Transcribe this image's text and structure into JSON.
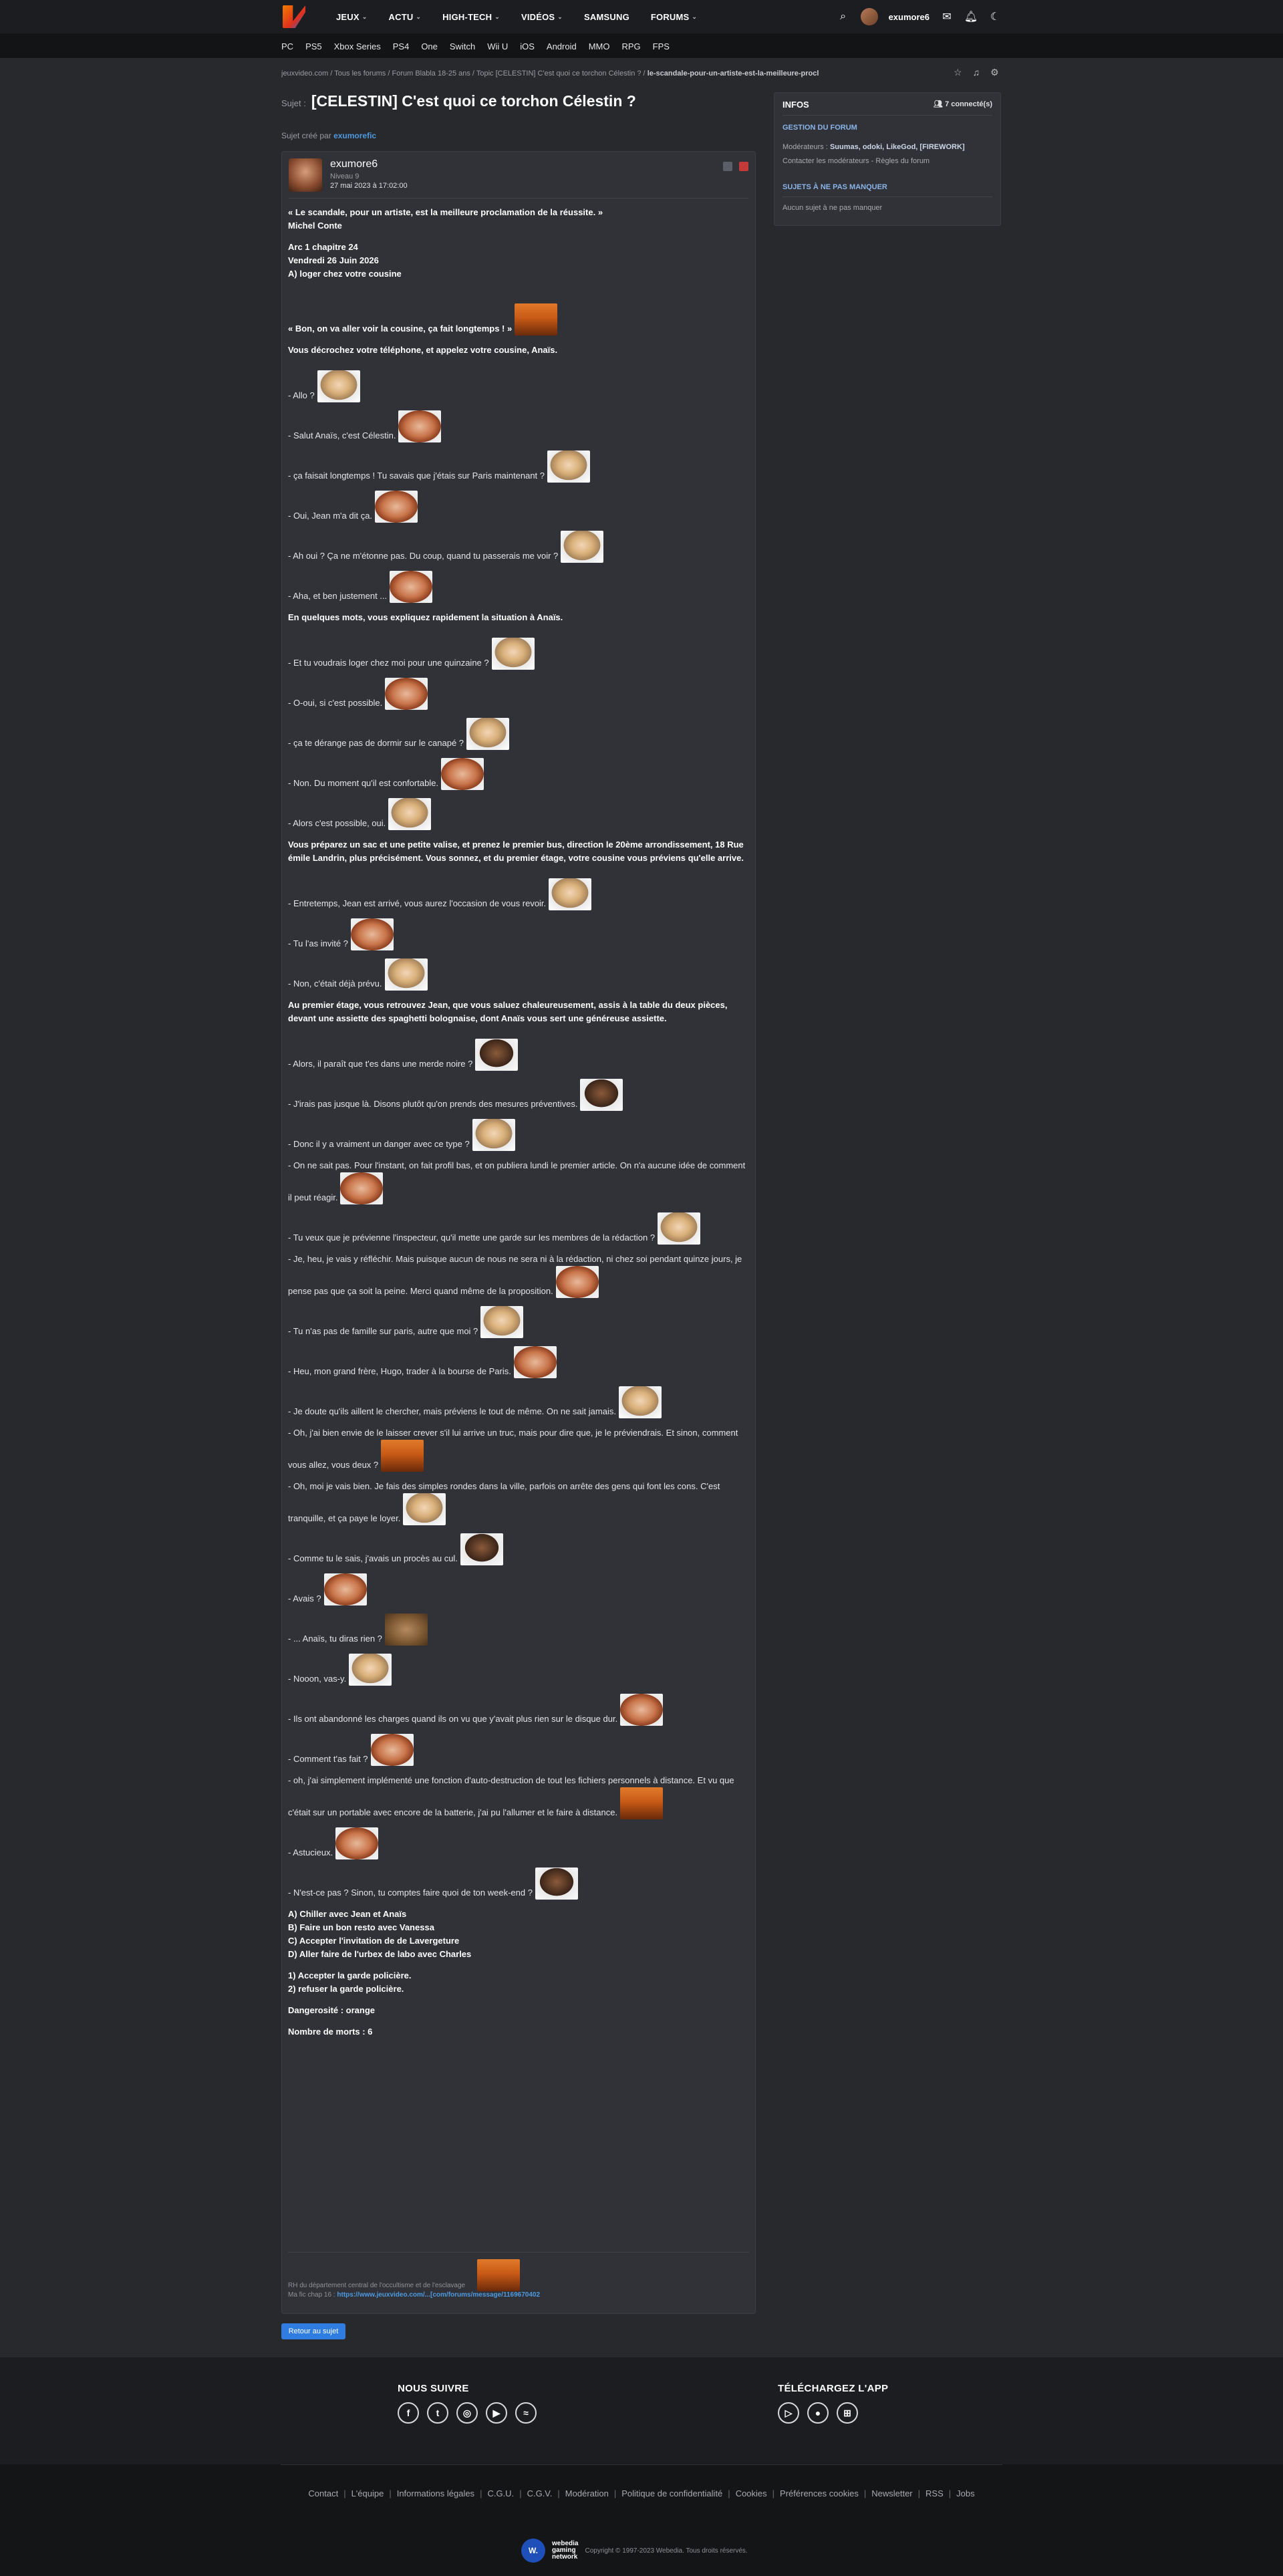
{
  "header": {
    "nav": [
      "JEUX",
      "ACTU",
      "HIGH-TECH",
      "VIDÉOS",
      "SAMSUNG",
      "FORUMS"
    ],
    "username": "exumore6"
  },
  "subnav": [
    "PC",
    "PS5",
    "Xbox Series",
    "PS4",
    "One",
    "Switch",
    "Wii U",
    "iOS",
    "Android",
    "MMO",
    "RPG",
    "FPS"
  ],
  "breadcrumb": {
    "path": "jeuxvideo.com / Tous les forums / Forum Blabla 18-25 ans / Topic [CELESTIN] C'est quoi ce torchon Célestin ? /",
    "current": "le-scandale-pour-un-artiste-est-la-meilleure-procl"
  },
  "subject": {
    "label": "Sujet :",
    "title": "[CELESTIN] C'est quoi ce torchon Célestin ?",
    "created_by_label": "Sujet créé par",
    "created_by": "exumorefic"
  },
  "post": {
    "author": "exumore6",
    "level": "Niveau 9",
    "date": "27 mai 2023 à 17:02:00",
    "signature_line1": "RH du département central de l'occultisme et de l'esclavage",
    "signature_line2_label": "Ma fic chap 16 :",
    "signature_link": "https://www.jeuxvideo.com/...[com/forums/message/1169670402"
  },
  "message": [
    {
      "t": "« Le scandale, pour un artiste, est la meilleure proclamation de la réussite. »",
      "b": true
    },
    {
      "t": "Michel Conte",
      "b": true
    },
    {
      "gap": true
    },
    {
      "t": "Arc 1 chapitre 24",
      "b": true
    },
    {
      "t": "Vendredi 26 Juin 2026",
      "b": true
    },
    {
      "t": "A) loger chez votre cousine",
      "b": true
    },
    {
      "gap": true,
      "big": true
    },
    {
      "t": "« Bon, on va aller voir la cousine, ça fait longtemps ! »",
      "b": true,
      "s": "orange"
    },
    {
      "t": "Vous décrochez votre téléphone, et appelez votre cousine, Anaïs.",
      "b": true
    },
    {
      "gap": true
    },
    {
      "t": "- Allo ?",
      "s": "blonde"
    },
    {
      "t": "- Salut Anaïs, c'est Célestin.",
      "s": "risitas"
    },
    {
      "t": "- ça faisait longtemps ! Tu savais que j'étais sur Paris maintenant ?",
      "s": "blonde"
    },
    {
      "t": "- Oui, Jean m'a dit ça.",
      "s": "risitas"
    },
    {
      "t": "- Ah oui ? Ça ne m'étonne pas. Du coup, quand tu passerais me voir ?",
      "s": "blonde"
    },
    {
      "t": "- Aha, et ben justement ...",
      "s": "risitas"
    },
    {
      "t": "En quelques mots, vous expliquez rapidement la situation à Anaïs.",
      "b": true
    },
    {
      "gap": true
    },
    {
      "t": "- Et tu voudrais loger chez moi pour une quinzaine ?",
      "s": "blonde"
    },
    {
      "t": "- O-oui, si c'est possible.",
      "s": "risitas"
    },
    {
      "t": "- ça te dérange pas de dormir sur le canapé ?",
      "s": "blonde"
    },
    {
      "t": "- Non. Du moment qu'il est confortable.",
      "s": "risitas"
    },
    {
      "t": "- Alors c'est possible, oui.",
      "s": "blonde"
    },
    {
      "t": "Vous préparez un sac et une petite valise, et prenez le premier bus, direction le 20ème arrondissement, 18 Rue émile Landrin, plus précisément. Vous sonnez, et du premier étage, votre cousine vous préviens qu'elle arrive.",
      "b": true
    },
    {
      "gap": true
    },
    {
      "t": "- Entretemps, Jean est arrivé, vous aurez l'occasion de vous revoir.",
      "s": "blonde"
    },
    {
      "t": "- Tu l'as invité ?",
      "s": "risitas"
    },
    {
      "t": "- Non, c'était déjà prévu.",
      "s": "blonde"
    },
    {
      "t": "Au premier étage, vous retrouvez Jean, que vous saluez chaleureusement, assis à la table du deux pièces, devant une assiette des spaghetti bolognaise, dont Anaïs vous sert une généreuse assiette.",
      "b": true
    },
    {
      "gap": true
    },
    {
      "t": "- Alors, il paraît que t'es dans une merde noire ?",
      "s": "dark"
    },
    {
      "t": "- J'irais pas jusque là. Disons plutôt qu'on prends des mesures préventives.",
      "s": "dark"
    },
    {
      "t": "- Donc il y a vraiment un danger avec ce type ?",
      "s": "blonde"
    },
    {
      "t": "- On ne sait pas. Pour l'instant, on fait profil bas, et on publiera lundi le premier article. On n'a aucune idée de comment il peut réagir.",
      "s": "risitas"
    },
    {
      "t": "- Tu veux que je prévienne l'inspecteur, qu'il mette une garde sur les membres de la rédaction ?",
      "s": "blonde"
    },
    {
      "t": "- Je, heu, je vais y réfléchir. Mais puisque aucun de nous ne sera ni à la rédaction, ni chez soi pendant quinze jours, je pense pas que ça soit la peine. Merci quand même de la proposition.",
      "s": "risitas"
    },
    {
      "t": "- Tu n'as pas de famille sur paris, autre que moi ?",
      "s": "blonde"
    },
    {
      "t": "- Heu, mon grand frère, Hugo, trader à la bourse de Paris.",
      "s": "risitas"
    },
    {
      "t": "- Je doute qu'ils aillent le chercher, mais préviens le tout de même. On ne sait jamais.",
      "s": "blonde"
    },
    {
      "t": "- Oh, j'ai bien envie de le laisser crever s'il lui arrive un truc, mais pour dire que, je le préviendrais. Et sinon, comment vous allez, vous deux ?",
      "s": "orange"
    },
    {
      "t": "- Oh, moi je vais bien. Je fais des simples rondes dans la ville, parfois on arrête des gens qui font les cons. C'est tranquille, et ça paye le loyer.",
      "s": "blonde"
    },
    {
      "t": "- Comme tu le sais, j'avais un procès au cul.",
      "s": "dark"
    },
    {
      "t": "- Avais ?",
      "s": "risitas"
    },
    {
      "t": "- ... Anaïs, tu diras rien ?",
      "s": "brown"
    },
    {
      "t": "- Nooon, vas-y.",
      "s": "blonde"
    },
    {
      "t": "- Ils ont abandonné les charges quand ils on vu que y'avait plus rien sur le disque dur.",
      "s": "risitas"
    },
    {
      "t": "- Comment t'as fait ?",
      "s": "risitas"
    },
    {
      "t": "- oh, j'ai simplement implémenté une fonction d'auto-destruction de tout les fichiers personnels à distance. Et vu que c'était sur un portable avec encore de la batterie, j'ai pu l'allumer et le faire à distance.",
      "s": "orange"
    },
    {
      "t": "- Astucieux.",
      "s": "risitas"
    },
    {
      "t": "- N'est-ce pas ? Sinon, tu comptes faire quoi de ton week-end ?",
      "s": "dark"
    },
    {
      "t": "A) Chiller avec Jean et Anaïs",
      "b": true
    },
    {
      "t": "B) Faire un bon resto avec Vanessa",
      "b": true
    },
    {
      "t": "C) Accepter l'invitation de de Lavergeture",
      "b": true
    },
    {
      "t": "D) Aller faire de l'urbex de labo avec Charles",
      "b": true
    },
    {
      "gap": true
    },
    {
      "t": "1) Accepter la garde policière.",
      "b": true
    },
    {
      "t": "2) refuser la garde policière.",
      "b": true
    },
    {
      "gap": true
    },
    {
      "t": "Dangerosité : orange",
      "b": true
    },
    {
      "gap": true
    },
    {
      "t": "Nombre de morts : 6",
      "b": true
    }
  ],
  "back_button": "Retour au sujet",
  "sidebar": {
    "title": "INFOS",
    "connected": "7 connecté(s)",
    "section1": "GESTION DU FORUM",
    "moderators_label": "Modérateurs :",
    "moderators": "Suumas, odoki, LikeGod, [FIREWORK]",
    "contact": "Contacter les modérateurs - Règles du forum",
    "section2": "SUJETS À NE PAS MANQUER",
    "none": "Aucun sujet à ne pas manquer"
  },
  "footer": {
    "follow_title": "NOUS SUIVRE",
    "app_title": "TÉLÉCHARGEZ L'APP",
    "links": [
      "Contact",
      "L'équipe",
      "Informations légales",
      "C.G.U.",
      "C.G.V.",
      "Modération",
      "Politique de confidentialité",
      "Cookies",
      "Préférences cookies",
      "Newsletter",
      "RSS",
      "Jobs"
    ],
    "copyright": "Copyright © 1997-2023 Webedia. Tous droits réservés."
  }
}
